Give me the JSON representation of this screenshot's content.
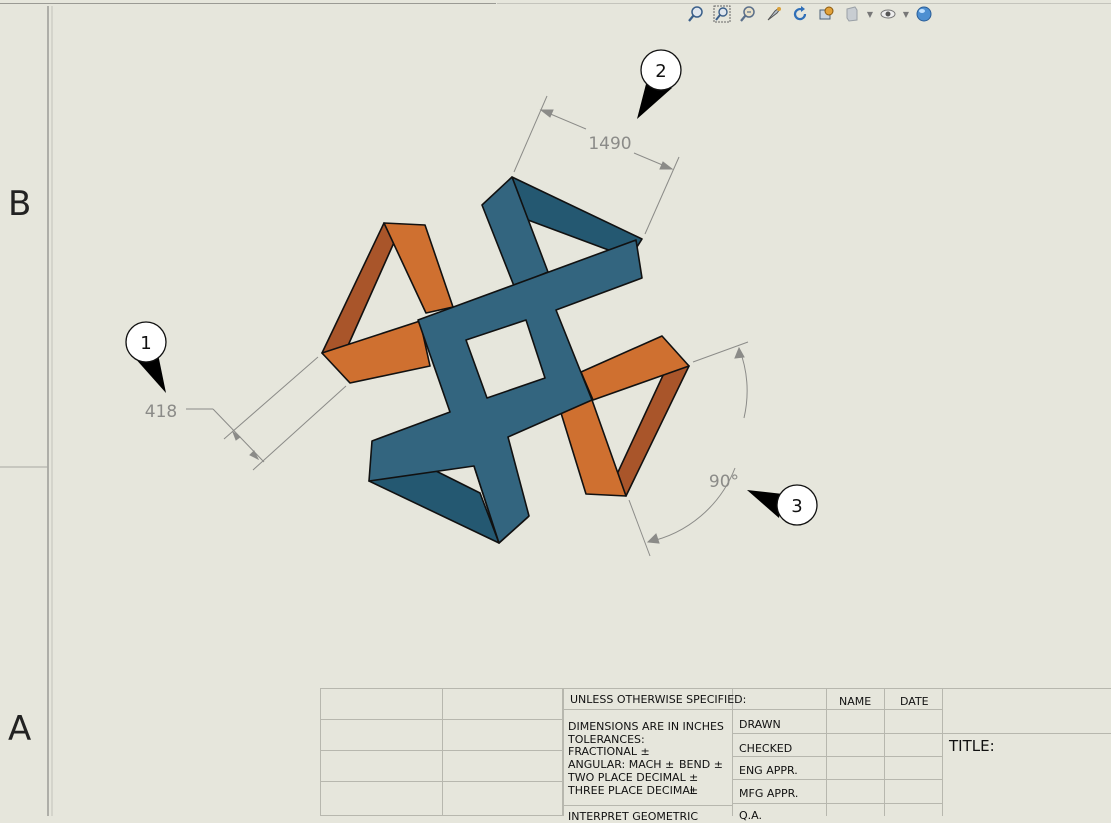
{
  "zones": {
    "upper": "B",
    "lower": "A"
  },
  "toolbar": {
    "icons": [
      "zoom-to-fit-icon",
      "zoom-area-icon",
      "zoom-in-out-icon",
      "pan-icon",
      "rotate-icon",
      "display-style-icon",
      "section-view-icon",
      "hide-show-icon",
      "appearance-icon"
    ]
  },
  "dimensions": {
    "length": "1490",
    "width": "418",
    "angle": "90°"
  },
  "balloons": {
    "b1": "1",
    "b2": "2",
    "b3": "3"
  },
  "colors": {
    "orange": "#cf7030",
    "orange_dark": "#a9552a",
    "blue": "#33657f",
    "blue_dark": "#245871",
    "paper": "#e6e6dc"
  },
  "title_block": {
    "unless": "UNLESS OTHERWISE SPECIFIED:",
    "name": "NAME",
    "date": "DATE",
    "dims_in_inches": "DIMENSIONS ARE IN INCHES",
    "tolerances": "TOLERANCES:",
    "fractional": "FRACTIONAL ±",
    "angular": "ANGULAR: MACH ±",
    "bend": "BEND ±",
    "two_place": "TWO PLACE DECIMAL",
    "three_place": "THREE PLACE DECIMAL",
    "plusminus": "±",
    "interpret": "INTERPRET GEOMETRIC",
    "drawn": "DRAWN",
    "checked": "CHECKED",
    "eng_appr": "ENG APPR.",
    "mfg_appr": "MFG APPR.",
    "qa": "Q.A.",
    "title": "TITLE:"
  }
}
